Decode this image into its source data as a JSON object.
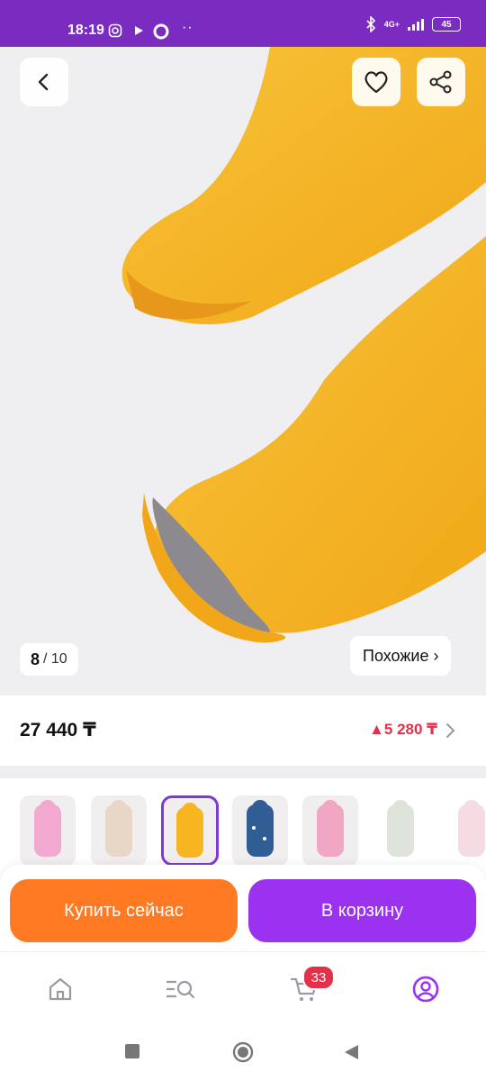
{
  "status_bar": {
    "time": "18:19",
    "network": "4G+",
    "battery": "45"
  },
  "gallery": {
    "counter_current": "8",
    "counter_total": "/ 10",
    "similar_label": "Похожие ›"
  },
  "price": {
    "current": "27 440 ₸",
    "difference": "▲5 280 ₸"
  },
  "variants": [
    {
      "color_name": "pink",
      "hex": "#f3a9cf"
    },
    {
      "color_name": "beige",
      "hex": "#e8d6c6"
    },
    {
      "color_name": "yellow",
      "hex": "#f6b521",
      "selected": true
    },
    {
      "color_name": "navy-print",
      "hex": "#2f5d94"
    },
    {
      "color_name": "rose",
      "hex": "#f1a6c4"
    },
    {
      "color_name": "sage",
      "hex": "#dfe4da"
    },
    {
      "color_name": "light-pink",
      "hex": "#f5dce2"
    }
  ],
  "actions": {
    "buy_now": "Купить сейчас",
    "add_to_cart": "В корзину"
  },
  "nav": {
    "cart_badge": "33",
    "accent": "#9a32ef"
  },
  "colors": {
    "status_bar": "#7a2bc0",
    "orange": "#ff7a22",
    "purple": "#9a32ef",
    "red": "#e5304a"
  }
}
